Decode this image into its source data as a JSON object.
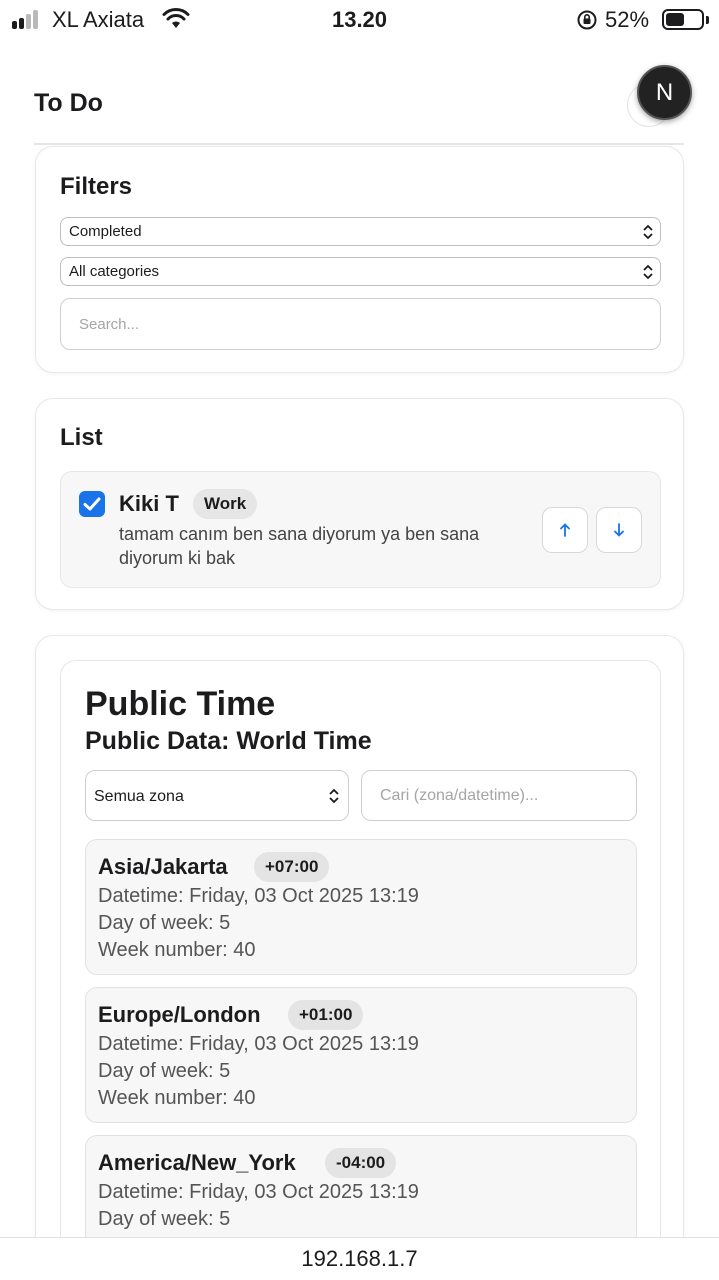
{
  "status_bar": {
    "carrier": "XL Axiata",
    "time": "13.20",
    "battery_percent": "52%",
    "battery_level": 0.52
  },
  "header": {
    "title": "To Do",
    "avatar_letter": "N"
  },
  "filters": {
    "title": "Filters",
    "status_select": "Completed",
    "category_select": "All categories",
    "search_placeholder": "Search..."
  },
  "list": {
    "title": "List",
    "items": [
      {
        "name": "Kiki T",
        "tag": "Work",
        "description": "tamam canım ben sana diyorum ya ben sana diyorum ki bak",
        "completed": true,
        "move_up_icon": "arrow-up-icon",
        "move_down_icon": "arrow-down-icon"
      }
    ]
  },
  "public_time": {
    "title": "Public Time",
    "subtitle": "Public Data: World Time",
    "zone_select": "Semua zona",
    "search_placeholder": "Cari (zona/datetime)...",
    "zones": [
      {
        "name": "Asia/Jakarta",
        "offset": "+07:00",
        "datetime": "Datetime: Friday, 03 Oct 2025 13:19",
        "day_of_week": "Day of week: 5",
        "week_number": "Week number: 40"
      },
      {
        "name": "Europe/London",
        "offset": "+01:00",
        "datetime": "Datetime: Friday, 03 Oct 2025 13:19",
        "day_of_week": "Day of week: 5",
        "week_number": "Week number: 40"
      },
      {
        "name": "America/New_York",
        "offset": "-04:00",
        "datetime": "Datetime: Friday, 03 Oct 2025 13:19",
        "day_of_week": "Day of week: 5"
      }
    ]
  },
  "browser": {
    "url": "192.168.1.7"
  },
  "colors": {
    "accent": "#1a73e8",
    "text": "#1c1c1e",
    "muted": "#555555"
  }
}
